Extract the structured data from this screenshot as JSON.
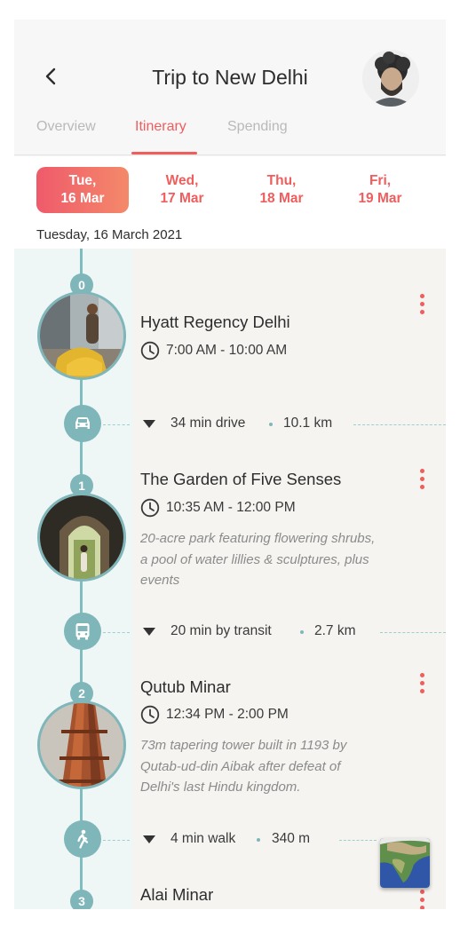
{
  "header": {
    "title": "Trip to New Delhi",
    "back_icon": "chevron-left-icon"
  },
  "tabs": [
    {
      "label": "Overview",
      "active": false
    },
    {
      "label": "Itinerary",
      "active": true
    },
    {
      "label": "Spending",
      "active": false
    }
  ],
  "dates": [
    {
      "day": "Tue,",
      "date": "16 Mar",
      "selected": true
    },
    {
      "day": "Wed,",
      "date": "17 Mar",
      "selected": false
    },
    {
      "day": "Thu,",
      "date": "18 Mar",
      "selected": false
    },
    {
      "day": "Fri,",
      "date": "19 Mar",
      "selected": false
    }
  ],
  "day_label": "Tuesday, 16 March 2021",
  "stops": [
    {
      "index": "0",
      "name": "Hyatt Regency Delhi",
      "time": "7:00 AM - 10:00 AM",
      "description": []
    },
    {
      "index": "1",
      "name": "The Garden of Five Senses",
      "time": "10:35 AM - 12:00 PM",
      "description": [
        "20-acre park featuring flowering shrubs,",
        "a pool of water lillies & sculptures, plus",
        "events"
      ]
    },
    {
      "index": "2",
      "name": "Qutub Minar",
      "time": "12:34 PM - 2:00 PM",
      "description": [
        "73m tapering tower built in 1193 by",
        "Qutab-ud-din Aibak after defeat of",
        "Delhi's last Hindu kingdom."
      ]
    },
    {
      "index": "3",
      "name": "Alai Minar",
      "time": "",
      "description": []
    }
  ],
  "legs": [
    {
      "mode_icon": "car-icon",
      "duration": "34 min drive",
      "distance": "10.1 km"
    },
    {
      "mode_icon": "bus-icon",
      "duration": "20 min by transit",
      "distance": "2.7 km"
    },
    {
      "mode_icon": "walk-icon",
      "duration": "4 min walk",
      "distance": "340 m"
    }
  ],
  "colors": {
    "accent": "#ef5d5d",
    "timeline": "#7fb6b9",
    "timeline_bg": "#eef6f6"
  }
}
